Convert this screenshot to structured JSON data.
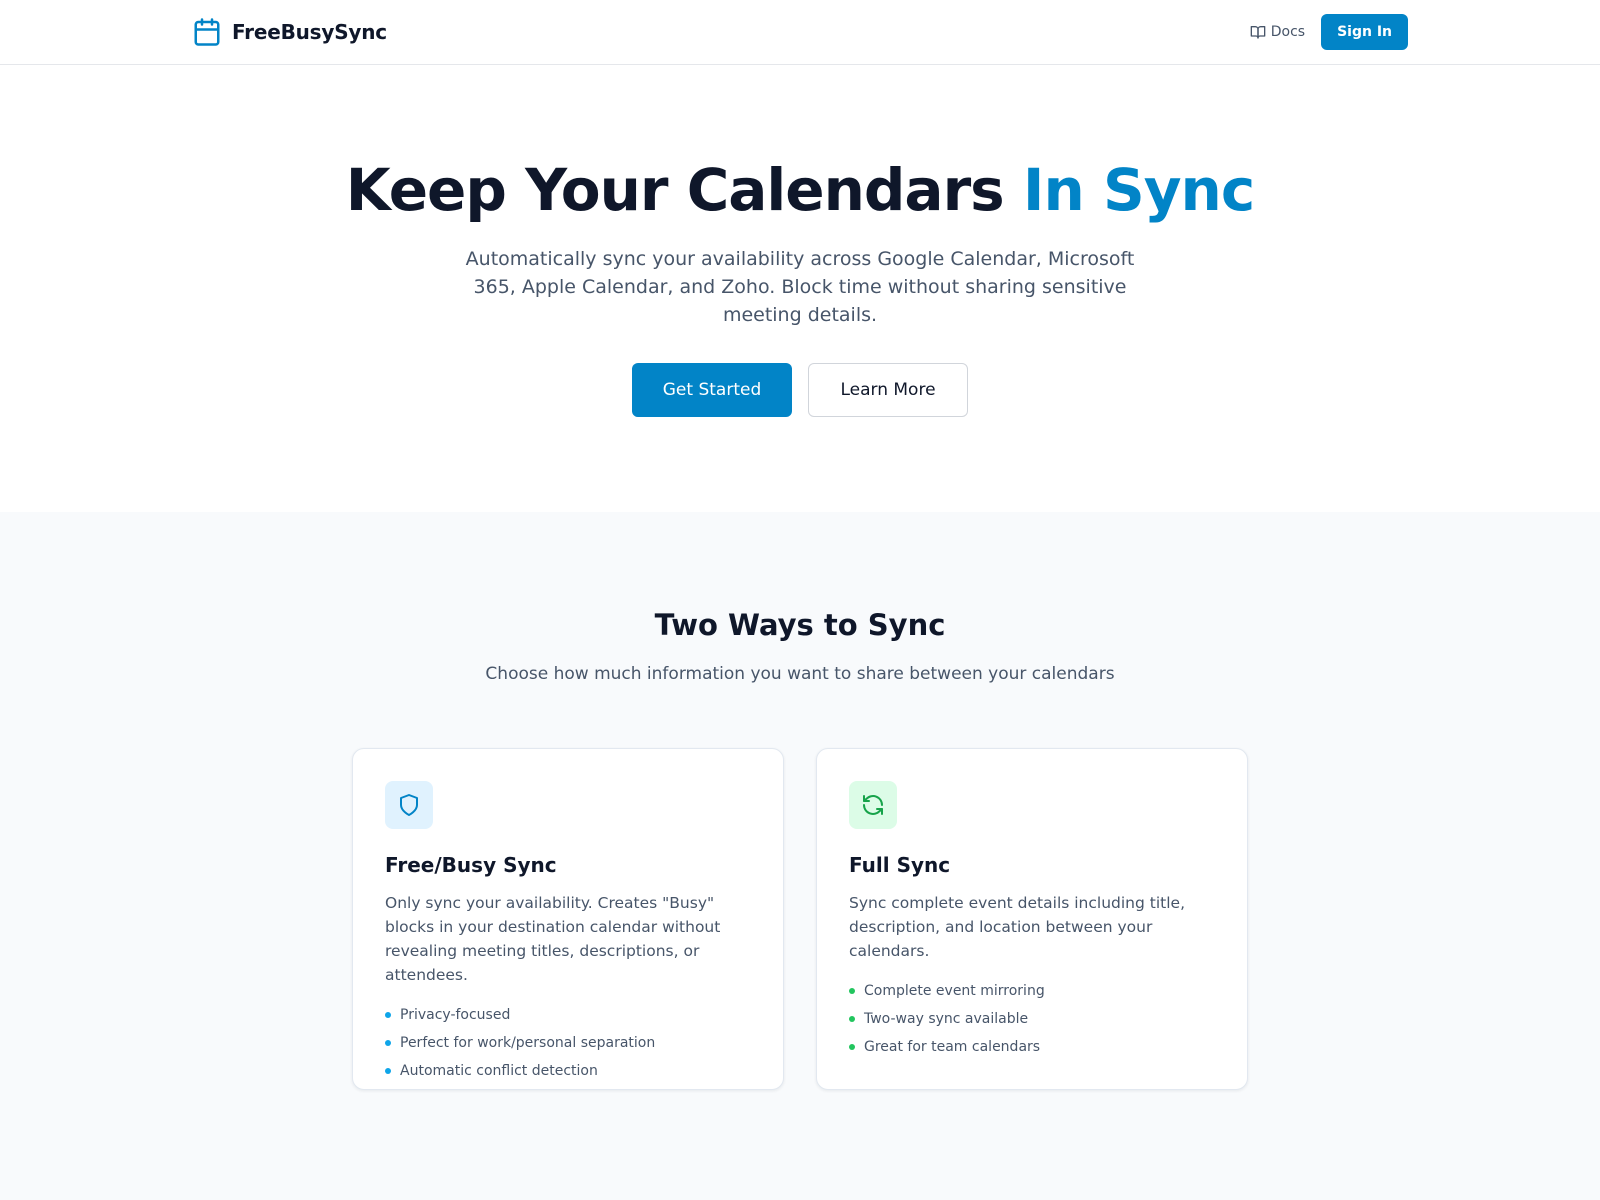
{
  "colors": {
    "accent": "#0284c7",
    "blue_dot": "#0ea5e9",
    "green_dot": "#22c55e",
    "blue_icon_bg": "#e0f2fe",
    "green_icon_bg": "#dcfce7",
    "green_icon": "#16a34a"
  },
  "header": {
    "logo_icon": "calendar-icon",
    "brand": "FreeBusySync",
    "docs_icon": "book-open-icon",
    "docs_label": "Docs",
    "signin_label": "Sign In"
  },
  "hero": {
    "title_main": "Keep Your Calendars ",
    "title_accent": "In Sync",
    "subtitle": "Automatically sync your availability across Google Calendar, Microsoft 365, Apple Calendar, and Zoho. Block time without sharing sensitive meeting details.",
    "primary_cta": "Get Started",
    "secondary_cta": "Learn More"
  },
  "features": {
    "title": "Two Ways to Sync",
    "subtitle": "Choose how much information you want to share between your calendars",
    "cards": [
      {
        "icon": "shield-icon",
        "title": "Free/Busy Sync",
        "description": "Only sync your availability. Creates \"Busy\" blocks in your destination calendar without revealing meeting titles, descriptions, or attendees.",
        "bullets": [
          "Privacy-focused",
          "Perfect for work/personal separation",
          "Automatic conflict detection"
        ]
      },
      {
        "icon": "refresh-icon",
        "title": "Full Sync",
        "description": "Sync complete event details including title, description, and location between your calendars.",
        "bullets": [
          "Complete event mirroring",
          "Two-way sync available",
          "Great for team calendars"
        ]
      }
    ]
  }
}
